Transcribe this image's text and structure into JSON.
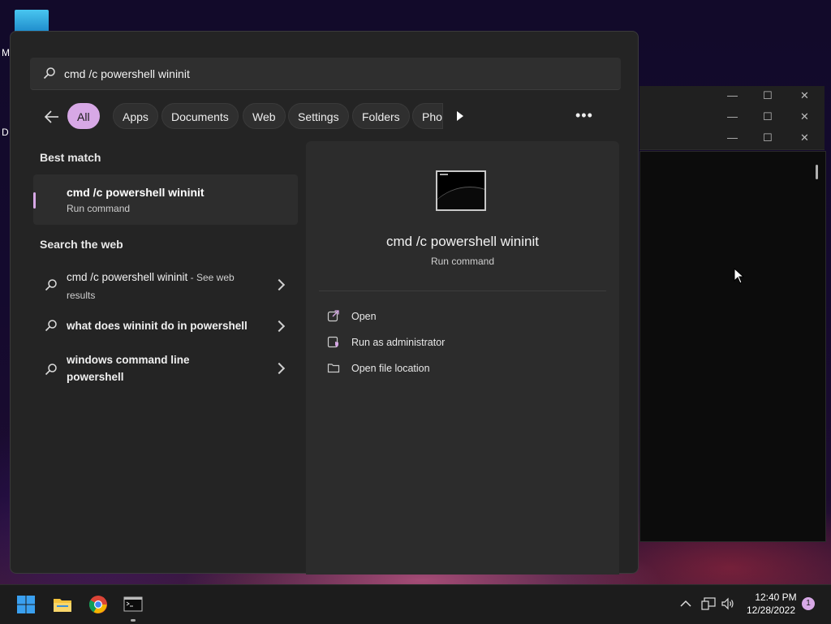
{
  "desktop": {
    "labels": [
      "M",
      "D"
    ]
  },
  "search": {
    "query": "cmd /c powershell wininit"
  },
  "filters": {
    "items": [
      "All",
      "Apps",
      "Documents",
      "Web",
      "Settings",
      "Folders",
      "Phot"
    ],
    "active": "All"
  },
  "results": {
    "best_match_heading": "Best match",
    "best": {
      "title": "cmd /c powershell wininit",
      "subtitle": "Run command"
    },
    "web_heading": "Search the web",
    "web": [
      {
        "main": "cmd /c powershell wininit",
        "suffix": " - See web results"
      },
      {
        "main": "what does wininit do in powershell"
      },
      {
        "main": "windows command line powershell"
      }
    ]
  },
  "preview": {
    "title": "cmd /c powershell wininit",
    "subtitle": "Run command",
    "actions": [
      {
        "label": "Open",
        "icon": "open-external-icon"
      },
      {
        "label": "Run as administrator",
        "icon": "admin-shield-icon"
      },
      {
        "label": "Open file location",
        "icon": "folder-icon"
      }
    ]
  },
  "taskbar": {
    "time": "12:40 PM",
    "date": "12/28/2022",
    "notifications": "1"
  },
  "colors": {
    "accent": "#d7a8e6",
    "panel": "#242424",
    "taskbar": "#1c1c1c"
  }
}
